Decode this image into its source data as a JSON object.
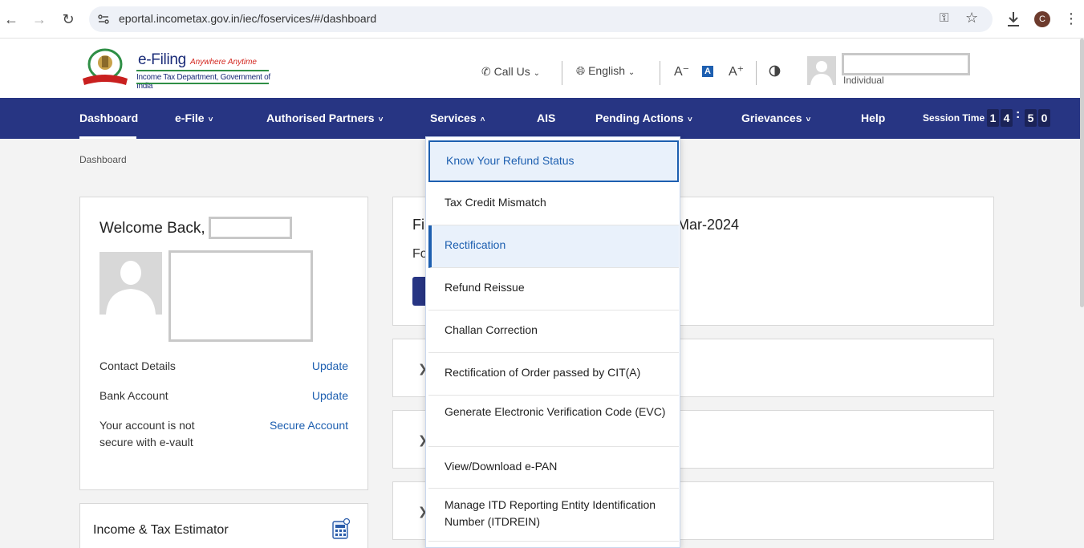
{
  "browser": {
    "url": "eportal.incometax.gov.in/iec/foservices/#/dashboard",
    "profile_initial": "C"
  },
  "header": {
    "brand": "e-Filing",
    "tagline": "Anywhere Anytime",
    "department": "Income Tax Department, Government of India",
    "call_us": "Call Us",
    "language": "English",
    "font_decrease": "A⁻",
    "font_normal": "A",
    "font_increase": "A⁺",
    "user_type": "Individual"
  },
  "nav": {
    "items": [
      "Dashboard",
      "e-File",
      "Authorised Partners",
      "Services",
      "AIS",
      "Pending Actions",
      "Grievances",
      "Help"
    ],
    "session_label": "Session Time",
    "session_digits": [
      "1",
      "4",
      "5",
      "0"
    ]
  },
  "breadcrumb": "Dashboard",
  "welcome": {
    "title": "Welcome Back,",
    "contact_label": "Contact Details",
    "contact_link": "Update",
    "bank_label": "Bank Account",
    "bank_link": "Update",
    "vault_label_1": "Your account is not",
    "vault_label_2": "secure with e-vault",
    "vault_link": "Secure Account"
  },
  "estimator": {
    "title": "Income & Tax Estimator"
  },
  "filing": {
    "title_start": "Fil",
    "title_end": "Mar-2024",
    "sub_start": "Fo"
  },
  "services_menu": {
    "items": [
      "Know Your Refund Status",
      "Tax Credit Mismatch",
      "Rectification",
      "Refund Reissue",
      "Challan Correction",
      "Rectification of Order passed by CIT(A)",
      "Generate Electronic Verification Code (EVC)",
      "View/Download e-PAN",
      "Manage ITD Reporting Entity Identification Number (ITDREIN)"
    ],
    "focused_index": 0,
    "hover_index": 2
  },
  "colors": {
    "navbar": "#273583",
    "link": "#1d5fb0",
    "menu_highlight": "#e9f1fb"
  }
}
